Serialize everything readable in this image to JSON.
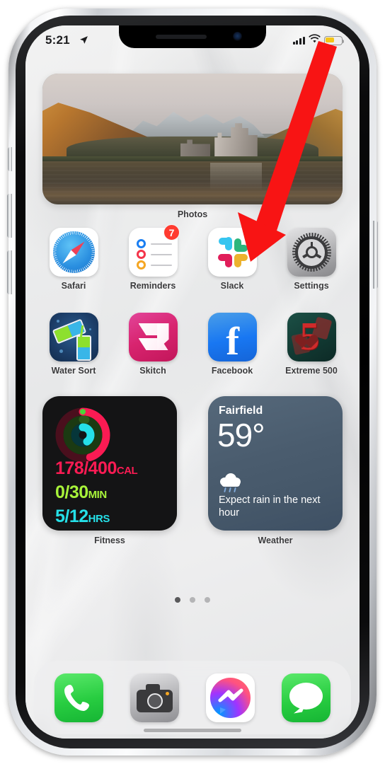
{
  "status_bar": {
    "time": "5:21",
    "location_icon": "location-arrow-icon",
    "cellular_icon": "signal-bars-icon",
    "wifi_icon": "wifi-icon",
    "battery_icon": "battery-low-power-icon",
    "battery_color": "#f5c518"
  },
  "photos_widget": {
    "label": "Photos",
    "scene": "castle-ruin-by-loch-with-mountains"
  },
  "apps_row_1": [
    {
      "label": "Safari",
      "icon": "safari-icon",
      "badge": null
    },
    {
      "label": "Reminders",
      "icon": "reminders-icon",
      "badge": "7"
    },
    {
      "label": "Slack",
      "icon": "slack-icon",
      "badge": null
    },
    {
      "label": "Settings",
      "icon": "settings-gear-icon",
      "badge": null
    }
  ],
  "apps_row_2": [
    {
      "label": "Water Sort",
      "icon": "water-sort-icon",
      "badge": null
    },
    {
      "label": "Skitch",
      "icon": "skitch-icon",
      "badge": null
    },
    {
      "label": "Facebook",
      "icon": "facebook-icon",
      "badge": null
    },
    {
      "label": "Extreme 500",
      "icon": "extreme-500-icon",
      "badge": null
    }
  ],
  "fitness_widget": {
    "label": "Fitness",
    "move_value": "178/400",
    "move_unit": "CAL",
    "move_color": "#fa1b53",
    "exercise_value": "0/30",
    "exercise_unit": "MIN",
    "exercise_color": "#a8f33a",
    "stand_value": "5/12",
    "stand_unit": "HRS",
    "stand_color": "#25e0e8"
  },
  "weather_widget": {
    "label": "Weather",
    "city": "Fairfield",
    "temperature": "59°",
    "condition_icon": "rain-cloud-icon",
    "description": "Expect rain in the next hour"
  },
  "page_dots": {
    "count": 3,
    "active_index": 0
  },
  "dock": [
    {
      "label": "Phone",
      "icon": "phone-icon"
    },
    {
      "label": "Camera",
      "icon": "camera-icon"
    },
    {
      "label": "Messenger",
      "icon": "messenger-icon"
    },
    {
      "label": "Messages",
      "icon": "messages-icon"
    }
  ],
  "annotation": {
    "arrow_icon": "red-arrow-pointing-down-left",
    "arrow_color": "#f81414"
  }
}
